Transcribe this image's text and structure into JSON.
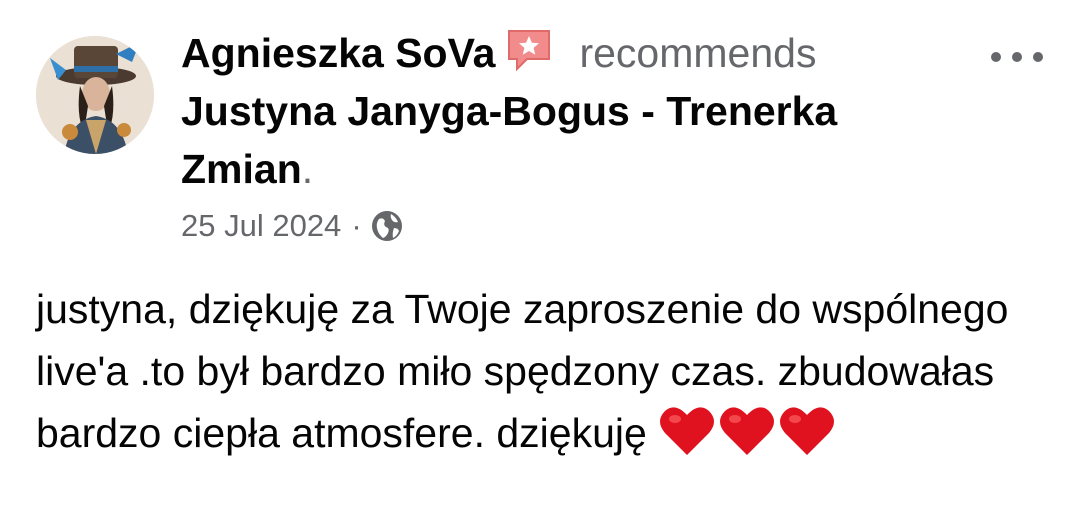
{
  "post": {
    "author": "Agnieszka SoVa",
    "verb": "recommends",
    "page_name": "Justyna Janyga-Bogus - Trenerka Zmian",
    "period": ".",
    "date": "25 Jul 2024",
    "separator": "·",
    "audience_icon": "globe-icon",
    "badge_icon": "recommendation-star-icon",
    "more_icon": "more-options-icon",
    "body": "justyna, dziękuję za Twoje zaproszenie do wspólnego live'a .to był bardzo miło spędzony czas. zbudowałas bardzo ciepła atmosfere. dziękuję",
    "reactions_emoji": [
      "heart",
      "heart",
      "heart"
    ]
  },
  "colors": {
    "text": "#050505",
    "secondary": "#65676b",
    "badge": "#f28b8b",
    "heart": "#e0121f"
  }
}
